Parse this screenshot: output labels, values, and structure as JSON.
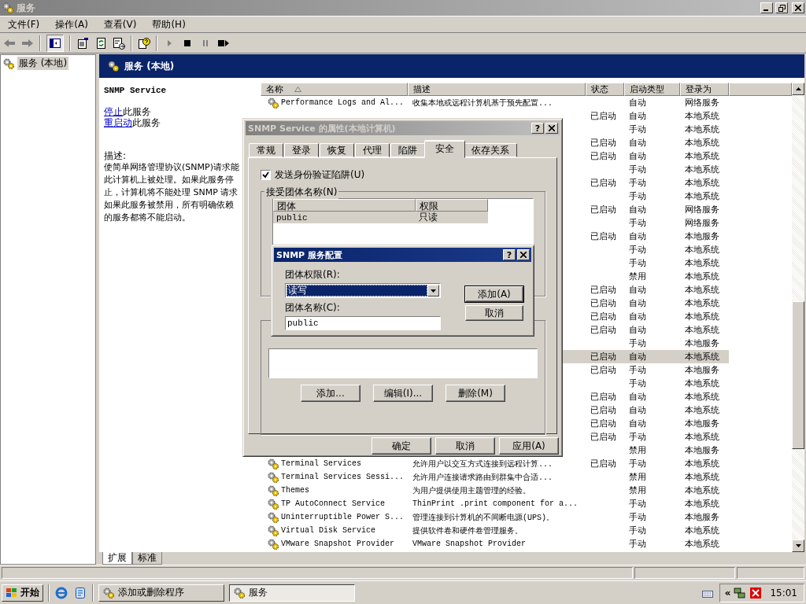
{
  "window": {
    "title": "服务"
  },
  "menu": [
    "文件(F)",
    "操作(A)",
    "查看(V)",
    "帮助(H)"
  ],
  "tree": [
    {
      "label": "服务 (本地)",
      "selected": true
    }
  ],
  "panel": {
    "header": "服务 (本地)",
    "service_name": "SNMP Service",
    "actions": [
      {
        "link": "停止",
        "text": "此服务"
      },
      {
        "link": "重启动",
        "text": "此服务"
      }
    ],
    "description_label": "描述:",
    "description_lines": [
      "使简单网络管理协议(SNMP)请求能",
      "此计算机上被处理。如果此服务停",
      "止，计算机将不能处理 SNMP 请求",
      "如果此服务被禁用，所有明确依赖",
      "的服务都将不能启动。"
    ]
  },
  "table": {
    "columns": [
      {
        "label": "名称",
        "sorted": true
      },
      {
        "label": "描述",
        "sorted": false
      },
      {
        "label": "状态",
        "sorted": false
      },
      {
        "label": "启动类型",
        "sorted": false
      },
      {
        "label": "登录为",
        "sorted": false
      }
    ],
    "rows": [
      {
        "name": "Performance Logs and Al...",
        "description": "收集本地或远程计算机基于预先配置...",
        "startup": "自动",
        "logon": "网络服务",
        "selected": false
      },
      {
        "status": "已启动",
        "startup": "自动",
        "logon": "本地系统",
        "selected": false
      },
      {
        "startup": "手动",
        "logon": "本地系统",
        "selected": false
      },
      {
        "status": "已启动",
        "startup": "自动",
        "logon": "本地系统",
        "selected": false
      },
      {
        "status": "已启动",
        "startup": "自动",
        "logon": "本地系统",
        "selected": false
      },
      {
        "startup": "手动",
        "logon": "本地系统",
        "selected": false
      },
      {
        "status": "已启动",
        "startup": "手动",
        "logon": "本地系统",
        "selected": false
      },
      {
        "startup": "手动",
        "logon": "本地系统",
        "selected": false
      },
      {
        "status": "已启动",
        "startup": "自动",
        "logon": "网络服务",
        "selected": false
      },
      {
        "startup": "手动",
        "logon": "网络服务",
        "selected": false
      },
      {
        "status": "已启动",
        "startup": "自动",
        "logon": "本地服务",
        "selected": false
      },
      {
        "startup": "手动",
        "logon": "本地系统",
        "selected": false
      },
      {
        "startup": "手动",
        "logon": "本地系统",
        "selected": false
      },
      {
        "startup": "禁用",
        "logon": "本地系统",
        "selected": false
      },
      {
        "status": "已启动",
        "startup": "自动",
        "logon": "本地系统",
        "selected": false
      },
      {
        "status": "已启动",
        "startup": "自动",
        "logon": "本地系统",
        "selected": false
      },
      {
        "status": "已启动",
        "startup": "自动",
        "logon": "本地系统",
        "selected": false
      },
      {
        "status": "已启动",
        "startup": "自动",
        "logon": "本地系统",
        "selected": false
      },
      {
        "startup": "手动",
        "logon": "本地服务",
        "selected": false
      },
      {
        "status": "已启动",
        "startup": "自动",
        "logon": "本地系统",
        "selected": true
      },
      {
        "status": "已启动",
        "startup": "手动",
        "logon": "本地服务",
        "selected": false
      },
      {
        "startup": "手动",
        "logon": "本地系统",
        "selected": false
      },
      {
        "status": "已启动",
        "startup": "自动",
        "logon": "本地系统",
        "selected": false
      },
      {
        "status": "已启动",
        "startup": "自动",
        "logon": "本地系统",
        "selected": false
      },
      {
        "status": "已启动",
        "startup": "自动",
        "logon": "本地服务",
        "selected": false
      },
      {
        "status": "已启动",
        "startup": "手动",
        "logon": "本地系统",
        "selected": false
      },
      {
        "startup": "禁用",
        "logon": "本地服务",
        "selected": false
      },
      {
        "name": "Terminal Services",
        "description": "允许用户以交互方式连接到远程计算...",
        "status": "已启动",
        "startup": "手动",
        "logon": "本地系统",
        "selected": false
      },
      {
        "name": "Terminal Services Sessi...",
        "description": "允许用户连接请求路由到群集中合适...",
        "startup": "禁用",
        "logon": "本地系统",
        "selected": false
      },
      {
        "name": "Themes",
        "description": "为用户提供使用主题管理的经验。",
        "startup": "禁用",
        "logon": "本地系统",
        "selected": false
      },
      {
        "name": "TP AutoConnect Service",
        "description": "ThinPrint .print component for a...",
        "startup": "手动",
        "logon": "本地系统",
        "selected": false
      },
      {
        "name": "Uninterruptible Power S...",
        "description": "管理连接到计算机的不间断电源(UPS)。",
        "startup": "手动",
        "logon": "本地服务",
        "selected": false
      },
      {
        "name": "Virtual Disk Service",
        "description": "提供软件卷和硬件卷管理服务。",
        "startup": "手动",
        "logon": "本地系统",
        "selected": false
      },
      {
        "name": "VMware Snapshot Provider",
        "description": "VMware Snapshot Provider",
        "startup": "手动",
        "logon": "本地系统",
        "selected": false
      }
    ]
  },
  "view_tabs": [
    {
      "label": "扩展",
      "selected": true
    },
    {
      "label": "标准",
      "selected": false
    }
  ],
  "properties_dialog": {
    "title": "SNMP Service 的属性(本地计算机)",
    "help": "?",
    "tabs": [
      {
        "label": "常规",
        "selected": false
      },
      {
        "label": "登录",
        "selected": false
      },
      {
        "label": "恢复",
        "selected": false
      },
      {
        "label": "代理",
        "selected": false
      },
      {
        "label": "陷阱",
        "selected": false
      },
      {
        "label": "安全",
        "selected": true
      },
      {
        "label": "依存关系",
        "selected": false
      }
    ],
    "send_auth_trap": {
      "label": "发送身份验证陷阱(U)",
      "checked": true
    },
    "communities": {
      "label": "接受团体名称(N)",
      "columns": [
        "团体",
        "权限"
      ],
      "rows": [
        {
          "community": "public",
          "rights": "只读",
          "selected": true
        }
      ]
    },
    "buttons": [
      "添加...",
      "编辑(I)...",
      "删除(M)"
    ],
    "footer_buttons": [
      "确定",
      "取消",
      "应用(A)"
    ]
  },
  "config_dialog": {
    "title": "SNMP 服务配置",
    "help": "?",
    "rights_label": "团体权限(R):",
    "rights_value": "读写",
    "name_label": "团体名称(C):",
    "name_value": "public",
    "buttons": [
      "添加(A)",
      "取消"
    ]
  },
  "taskbar": {
    "start": "开始",
    "tasks": [
      {
        "label": "添加或删除程序",
        "selected": false
      },
      {
        "label": "服务",
        "selected": true
      }
    ],
    "tray_expand": "«",
    "clock": "15:01"
  }
}
